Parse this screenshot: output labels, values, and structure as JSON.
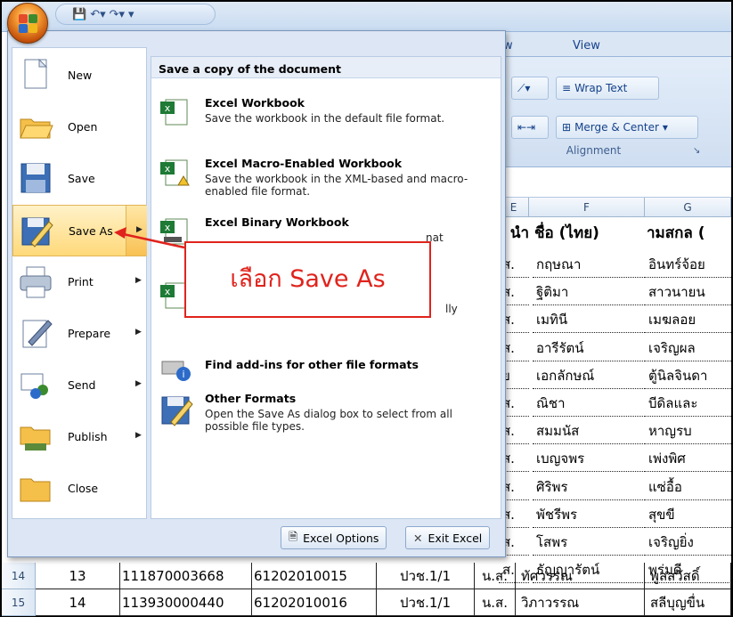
{
  "ribbon": {
    "tab_w": "w",
    "tab_view": "View",
    "wrap_text": "Wrap Text",
    "merge_center": "Merge & Center",
    "group_alignment": "Alignment"
  },
  "sheet": {
    "col_f": "F",
    "col_g": "G",
    "col_e": "E",
    "head_e": "นำ",
    "head_f": "ชื่อ (ไทย)",
    "head_g": "ามสกล (",
    "rows": [
      {
        "e": "ส.",
        "f": "กฤษณา",
        "g": "อินทร์จ้อย"
      },
      {
        "e": "ส.",
        "f": "ฐิติมา",
        "g": "สาวนายน"
      },
      {
        "e": "ส.",
        "f": "เมทินี",
        "g": "เมฆลอย"
      },
      {
        "e": "ส.",
        "f": "อารีรัตน์",
        "g": "เจริญผล"
      },
      {
        "e": "ย",
        "f": "เอกลักษณ์",
        "g": "ตู้นิลจินดา"
      },
      {
        "e": "ส.",
        "f": "ณิชา",
        "g": "บีดิลและ"
      },
      {
        "e": "ส.",
        "f": "สมมนัส",
        "g": "หาญรบ"
      },
      {
        "e": "ส.",
        "f": "เบญจพร",
        "g": "เพ่งพิศ"
      },
      {
        "e": "ส.",
        "f": "ศิริพร",
        "g": "แซ่อื้อ"
      },
      {
        "e": "ส.",
        "f": "พัชรีพร",
        "g": "สุขขี"
      },
      {
        "e": "ส.",
        "f": "โสพร",
        "g": "เจริญยิ่ง"
      },
      {
        "e": "ส.",
        "f": "ธัญญารัตน์",
        "g": "พร่มดี"
      }
    ],
    "grid_rows": [
      {
        "num": "14",
        "a": "13",
        "b": "111870003668",
        "c": "61202010015",
        "d": "ปวช.1/1",
        "e": "น.ส.",
        "f": "ทัศวรรณ",
        "g": "พูลสวัสดิ์"
      },
      {
        "num": "15",
        "a": "14",
        "b": "113930000440",
        "c": "61202010016",
        "d": "ปวช.1/1",
        "e": "น.ส.",
        "f": "วิภาวรรณ",
        "g": "สลีบุญขื่น"
      }
    ]
  },
  "menu": {
    "left": [
      {
        "label": "New",
        "icon": "new-document-icon",
        "arrow": false
      },
      {
        "label": "Open",
        "icon": "open-folder-icon",
        "arrow": false
      },
      {
        "label": "Save",
        "icon": "save-disk-icon",
        "arrow": false
      },
      {
        "label": "Save As",
        "icon": "save-as-icon",
        "arrow": true
      },
      {
        "label": "Print",
        "icon": "printer-icon",
        "arrow": true
      },
      {
        "label": "Prepare",
        "icon": "prepare-pen-icon",
        "arrow": true
      },
      {
        "label": "Send",
        "icon": "send-people-icon",
        "arrow": true
      },
      {
        "label": "Publish",
        "icon": "publish-server-icon",
        "arrow": true
      },
      {
        "label": "Close",
        "icon": "close-folder-icon",
        "arrow": false
      }
    ],
    "right_header": "Save a copy of the document",
    "right": [
      {
        "title": "Excel Workbook",
        "desc": "Save the workbook in the default file format.",
        "icon": "excel-workbook-icon"
      },
      {
        "title": "Excel Macro-Enabled Workbook",
        "desc": "Save the workbook in the XML-based and macro-enabled file format.",
        "icon": "excel-macro-icon"
      },
      {
        "title": "Excel Binary Workbook",
        "desc": "nat",
        "icon": "excel-binary-icon"
      },
      {
        "title": "",
        "desc": "lly",
        "icon": "excel-97-icon"
      },
      {
        "title": "Find add-ins for other file formats",
        "desc": "",
        "icon": "addins-info-icon"
      },
      {
        "title": "Other Formats",
        "desc": "Open the Save As dialog box to select from all possible file types.",
        "icon": "other-formats-icon"
      }
    ],
    "excel_options": "Excel Options",
    "exit_excel": "Exit Excel"
  },
  "callout": {
    "text": "เลือก Save As"
  },
  "colors": {
    "accent": "#e0231c",
    "menu_bg": "#dce6f4",
    "selected": "#ffd97a"
  }
}
